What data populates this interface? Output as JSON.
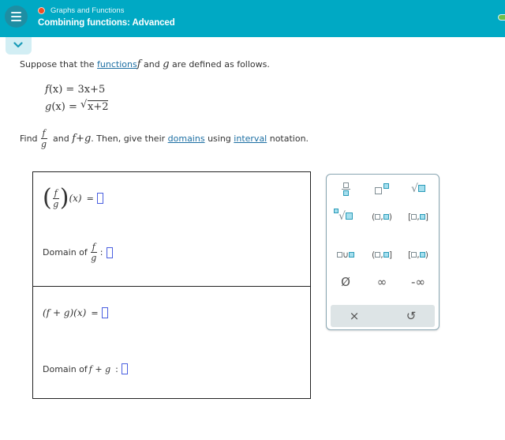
{
  "header": {
    "subject": "Graphs and Functions",
    "topic": "Combining functions: Advanced",
    "status_dot_color": "#ef4d24",
    "bar_color": "#00a9c4",
    "progress_color": "#6cc04a",
    "menu_icon": "hamburger-menu-icon",
    "collapse_icon": "chevron-down-icon"
  },
  "problem": {
    "intro_pre": "Suppose that the ",
    "intro_link": "functions",
    "intro_f": "f",
    "intro_and": " and ",
    "intro_g": "g",
    "intro_post": " are defined as follows.",
    "f_def": {
      "name": "f",
      "arg": "(x)",
      "eq": " = 3x+5"
    },
    "g_def": {
      "name": "g",
      "arg": "(x)",
      "eq": " = ",
      "radicand": "x+2"
    },
    "find_label": "Find",
    "find_frac_num": "f",
    "find_frac_den": "g",
    "find_mid": " and ",
    "find_sum": "f+g",
    "find_then": ". Then, give their ",
    "link_domains": "domains",
    "find_using": " using ",
    "link_interval": "interval",
    "find_end": " notation."
  },
  "answers": {
    "quotient_expr": {
      "num": "f",
      "den": "g",
      "arg": "(x)",
      "eq": "=",
      "value": ""
    },
    "quotient_domain": {
      "label": "Domain of",
      "num": "f",
      "den": "g",
      "colon": ":",
      "value": ""
    },
    "sum_expr": {
      "expr": "(f + g)(x)",
      "eq": "=",
      "value": ""
    },
    "sum_domain": {
      "label": "Domain of",
      "expr": "f + g",
      "colon": ":",
      "value": ""
    }
  },
  "keypad": {
    "keys": [
      {
        "name": "fraction-key",
        "icon": "fraction-icon"
      },
      {
        "name": "exponent-key",
        "icon": "superscript-icon"
      },
      {
        "name": "sqrt-key",
        "icon": "square-root-icon"
      },
      {
        "name": "nth-root-key",
        "icon": "nth-root-icon"
      },
      {
        "name": "open-interval-key",
        "text": "(□,□)"
      },
      {
        "name": "closed-interval-key",
        "text": "[□,□]"
      },
      {
        "name": "union-key",
        "text": "□∪□"
      },
      {
        "name": "left-open-interval-key",
        "text": "(□,□]"
      },
      {
        "name": "right-open-interval-key",
        "text": "[□,□)"
      },
      {
        "name": "empty-set-key",
        "text": "Ø"
      },
      {
        "name": "infinity-key",
        "text": "∞"
      },
      {
        "name": "neg-infinity-key",
        "text": "-∞"
      }
    ],
    "clear_label": "×",
    "undo_label": "↺"
  }
}
